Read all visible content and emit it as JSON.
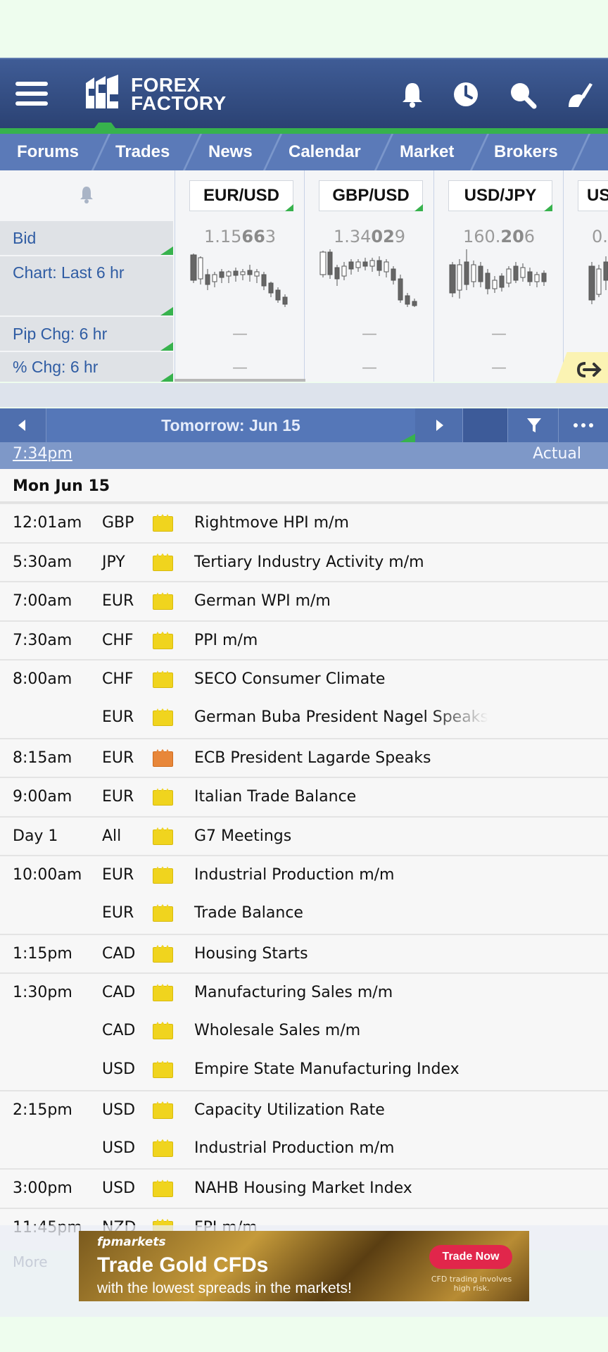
{
  "header": {
    "logo_line1": "FOREX",
    "logo_line2": "FACTORY",
    "icons": [
      "menu-icon",
      "bell-icon",
      "clock-icon",
      "search-icon",
      "user-icon"
    ]
  },
  "nav": {
    "items": [
      "Forums",
      "Trades",
      "News",
      "Calendar",
      "Market",
      "Brokers"
    ]
  },
  "market": {
    "labels": {
      "bid": "Bid",
      "chart": "Chart: Last 6 hr",
      "pip": "Pip Chg: 6 hr",
      "pct": "% Chg: 6 hr"
    },
    "pairs": [
      {
        "name": "EUR/USD",
        "bid_pre": "1.15",
        "bid_bold": "66",
        "bid_post": "3",
        "pip": "—",
        "pct": "—"
      },
      {
        "name": "GBP/USD",
        "bid_pre": "1.34",
        "bid_bold": "02",
        "bid_post": "9",
        "pip": "—",
        "pct": "—"
      },
      {
        "name": "USD/JPY",
        "bid_pre": "160.",
        "bid_bold": "20",
        "bid_post": "6",
        "pip": "—",
        "pct": "—"
      },
      {
        "name": "US",
        "bid_pre": "0.",
        "bid_bold": "",
        "bid_post": "",
        "pip": "",
        "pct": ""
      }
    ]
  },
  "daynav": {
    "title": "Tomorrow: Jun 15"
  },
  "timebar": {
    "now": "7:34pm",
    "actual": "Actual"
  },
  "calendar": {
    "date": "Mon Jun 15",
    "events": [
      {
        "time": "12:01am",
        "currency": "GBP",
        "impact": "low",
        "title": "Rightmove HPI m/m"
      },
      {
        "time": "5:30am",
        "currency": "JPY",
        "impact": "low",
        "title": "Tertiary Industry Activity m/m"
      },
      {
        "time": "7:00am",
        "currency": "EUR",
        "impact": "low",
        "title": "German WPI m/m"
      },
      {
        "time": "7:30am",
        "currency": "CHF",
        "impact": "low",
        "title": "PPI m/m"
      },
      {
        "time": "8:00am",
        "currency": "CHF",
        "impact": "low",
        "title": "SECO Consumer Climate"
      },
      {
        "time": "",
        "currency": "EUR",
        "impact": "low",
        "title": "German Buba President Nagel Speaks"
      },
      {
        "time": "8:15am",
        "currency": "EUR",
        "impact": "med",
        "title": "ECB President Lagarde Speaks"
      },
      {
        "time": "9:00am",
        "currency": "EUR",
        "impact": "low",
        "title": "Italian Trade Balance"
      },
      {
        "time": "Day 1",
        "currency": "All",
        "impact": "low",
        "title": "G7 Meetings"
      },
      {
        "time": "10:00am",
        "currency": "EUR",
        "impact": "low",
        "title": "Industrial Production m/m"
      },
      {
        "time": "",
        "currency": "EUR",
        "impact": "low",
        "title": "Trade Balance"
      },
      {
        "time": "1:15pm",
        "currency": "CAD",
        "impact": "low",
        "title": "Housing Starts"
      },
      {
        "time": "1:30pm",
        "currency": "CAD",
        "impact": "low",
        "title": "Manufacturing Sales m/m"
      },
      {
        "time": "",
        "currency": "CAD",
        "impact": "low",
        "title": "Wholesale Sales m/m"
      },
      {
        "time": "",
        "currency": "USD",
        "impact": "low",
        "title": "Empire State Manufacturing Index"
      },
      {
        "time": "2:15pm",
        "currency": "USD",
        "impact": "low",
        "title": "Capacity Utilization Rate"
      },
      {
        "time": "",
        "currency": "USD",
        "impact": "low",
        "title": "Industrial Production m/m"
      },
      {
        "time": "3:00pm",
        "currency": "USD",
        "impact": "low",
        "title": "NAHB Housing Market Index"
      },
      {
        "time": "11:45pm",
        "currency": "NZD",
        "impact": "low",
        "title": "FPI m/m"
      }
    ]
  },
  "ad": {
    "brand": "fpmarkets",
    "headline": "Trade Gold CFDs",
    "sub": "with the lowest spreads in the markets!",
    "cta": "Trade Now",
    "disclaimer": "CFD trading involves high risk.",
    "more": "More"
  },
  "colors": {
    "header": "#2f4a80",
    "nav": "#5b7ab8",
    "accent_green": "#37b24d",
    "impact_low": "#f0d41e",
    "impact_med": "#e8873a"
  }
}
